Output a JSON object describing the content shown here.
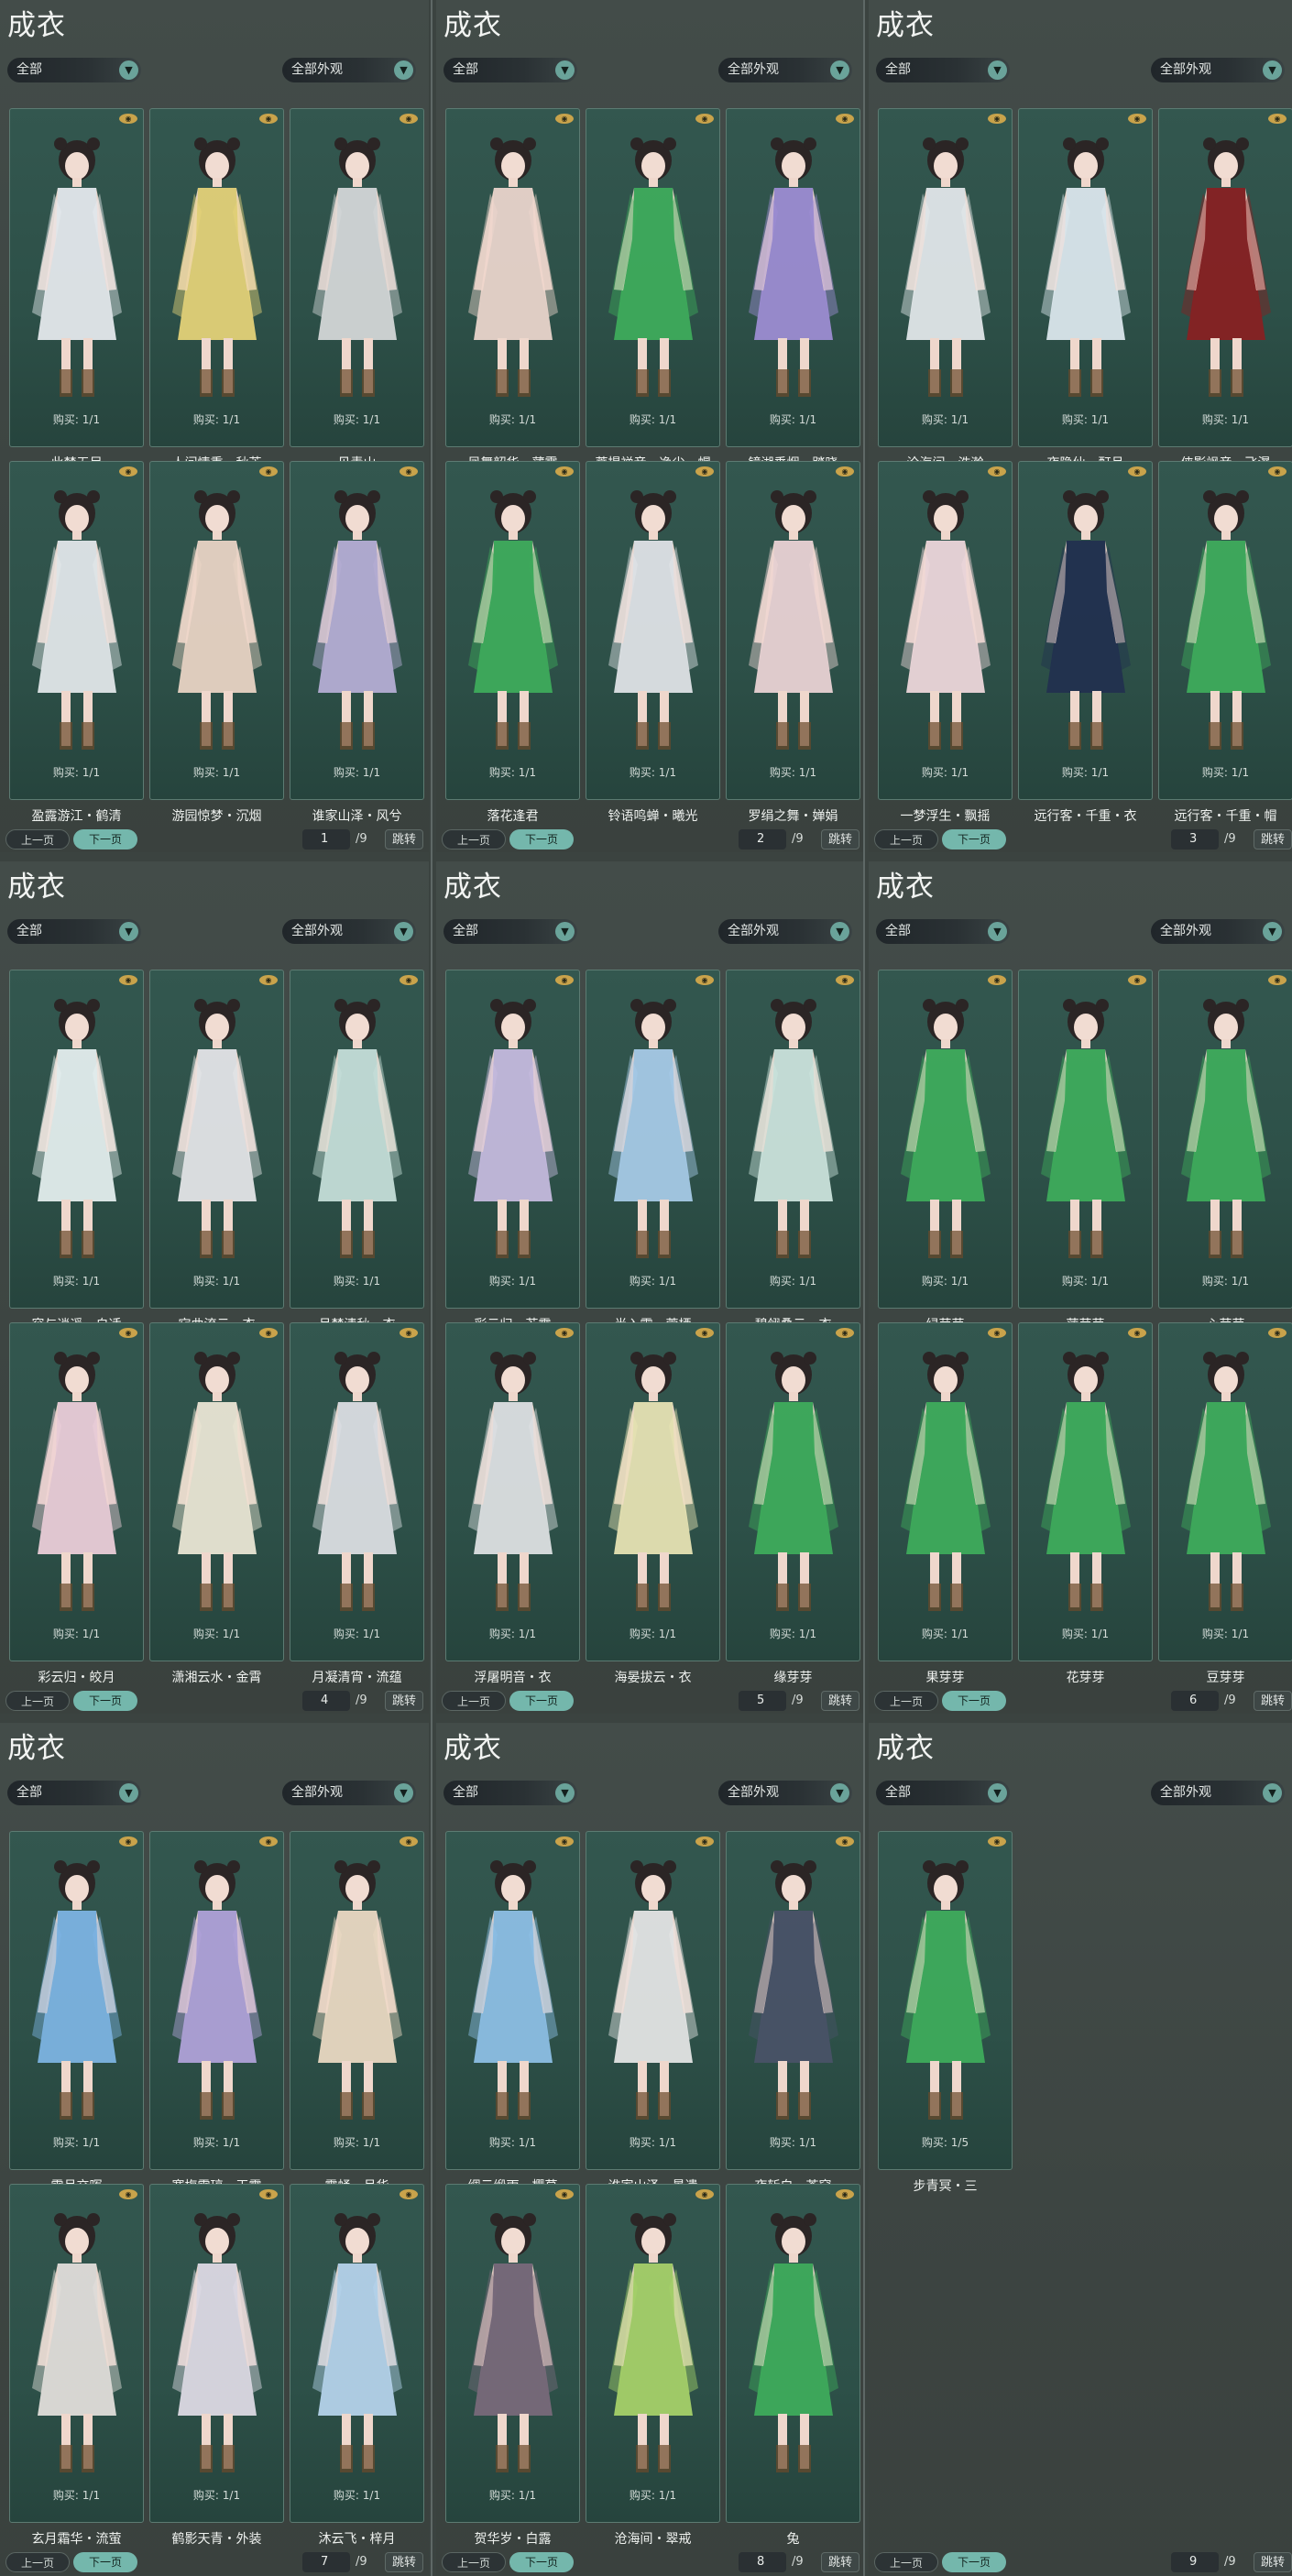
{
  "title": "成衣",
  "filter_category": "全部",
  "filter_appearance": "全部外观",
  "next_label": "下一页",
  "prev_label": "上一页",
  "jump_label": "跳转",
  "eye_icon": "eye-icon",
  "colors": {
    "background": "#3b4340",
    "card": "#2d5048",
    "accent": "#74b7ac",
    "eye": "#c9a34b"
  },
  "panels": [
    {
      "page": "1",
      "total": "/9",
      "items": [
        {
          "name": "此梦无尽",
          "buy": "购买: 1/1",
          "color": "#e9edf1"
        },
        {
          "name": "人间情重・秋芳",
          "buy": "购买: 1/1",
          "color": "#e8d57a"
        },
        {
          "name": "见青山",
          "buy": "购买: 1/1",
          "color": "#d8dadb"
        },
        {
          "name": "盈露游江・鹤清",
          "buy": "购买: 1/1",
          "color": "#e6eaee"
        },
        {
          "name": "游园惊梦・沉烟",
          "buy": "购买: 1/1",
          "color": "#eed7c8"
        },
        {
          "name": "谁家山泽・风兮",
          "buy": "购买: 1/1",
          "color": "#b8b0d8"
        }
      ]
    },
    {
      "page": "2",
      "total": "/9",
      "items": [
        {
          "name": "凤舞韶华・薄雾",
          "buy": "购买: 1/1",
          "color": "#efd8cf"
        },
        {
          "name": "菩提禅音・净尘・帽",
          "buy": "购买: 1/1",
          "color": "#3fae5c"
        },
        {
          "name": "镜湖垂烟・踏晓",
          "buy": "购买: 1/1",
          "color": "#a08ed6"
        },
        {
          "name": "落花逢君",
          "buy": "购买: 1/1",
          "color": "#3fae5c"
        },
        {
          "name": "铃语鸣蝉・曦光",
          "buy": "购买: 1/1",
          "color": "#e4e6ea"
        },
        {
          "name": "罗绢之舞・婵娟",
          "buy": "购买: 1/1",
          "color": "#efd6d8"
        }
      ]
    },
    {
      "page": "3",
      "total": "/9",
      "items": [
        {
          "name": "沧海间・浩瀚",
          "buy": "购买: 1/1",
          "color": "#e6eaee"
        },
        {
          "name": "夜隐仙・酊月",
          "buy": "购买: 1/1",
          "color": "#dfeaf1"
        },
        {
          "name": "侠影飒音・飞瀑",
          "buy": "购买: 1/1",
          "color": "#8a1f22"
        },
        {
          "name": "一梦浮生・飘摇",
          "buy": "购买: 1/1",
          "color": "#f2dade"
        },
        {
          "name": "远行客・千重・衣",
          "buy": "购买: 1/1",
          "color": "#22304f"
        },
        {
          "name": "远行客・千重・帽",
          "buy": "购买: 1/1",
          "color": "#3fae5c"
        }
      ]
    },
    {
      "page": "4",
      "total": "/9",
      "items": [
        {
          "name": "容与逍遥・自适",
          "buy": "购买: 1/1",
          "color": "#e8f2f2"
        },
        {
          "name": "宛曲流云・衣",
          "buy": "购买: 1/1",
          "color": "#e8e8ec"
        },
        {
          "name": "月梦清秋・衣",
          "buy": "购买: 1/1",
          "color": "#c9e2dc"
        },
        {
          "name": "彩云归・皎月",
          "buy": "购买: 1/1",
          "color": "#f0d0dc"
        },
        {
          "name": "潇湘云水・金霄",
          "buy": "购买: 1/1",
          "color": "#efe9d8"
        },
        {
          "name": "月凝清宵・流蕴",
          "buy": "购买: 1/1",
          "color": "#e0e2e6"
        }
      ]
    },
    {
      "page": "5",
      "total": "/9",
      "items": [
        {
          "name": "彩云归・若霞",
          "buy": "购买: 1/1",
          "color": "#c9bde2"
        },
        {
          "name": "半入霜・萱栖",
          "buy": "购买: 1/1",
          "color": "#a9cdea"
        },
        {
          "name": "碧翎叠云・衣",
          "buy": "购买: 1/1",
          "color": "#cfe6e0"
        },
        {
          "name": "浮屠明音・衣",
          "buy": "购买: 1/1",
          "color": "#e2e4e6"
        },
        {
          "name": "海晏拔云・衣",
          "buy": "购买: 1/1",
          "color": "#ece6b6"
        },
        {
          "name": "缘芽芽",
          "buy": "购买: 1/1",
          "color": "#3fae5c"
        }
      ]
    },
    {
      "page": "6",
      "total": "/9",
      "items": [
        {
          "name": "绿芽芽",
          "buy": "购买: 1/1",
          "color": "#3fae5c"
        },
        {
          "name": "萍芽芽",
          "buy": "购买: 1/1",
          "color": "#3fae5c"
        },
        {
          "name": "心芽芽",
          "buy": "购买: 1/1",
          "color": "#3fae5c"
        },
        {
          "name": "果芽芽",
          "buy": "购买: 1/1",
          "color": "#3fae5c"
        },
        {
          "name": "花芽芽",
          "buy": "购买: 1/1",
          "color": "#3fae5c"
        },
        {
          "name": "豆芽芽",
          "buy": "购买: 1/1",
          "color": "#3fae5c"
        }
      ]
    },
    {
      "page": "7",
      "total": "/9",
      "items": [
        {
          "name": "雪月交晖",
          "buy": "购买: 1/1",
          "color": "#7fb6e6"
        },
        {
          "name": "寒梅雪琼・玉露",
          "buy": "购买: 1/1",
          "color": "#b3a4dc"
        },
        {
          "name": "霞蛹・月华",
          "buy": "购买: 1/1",
          "color": "#efdcc6"
        },
        {
          "name": "玄月霜华・流萤",
          "buy": "购买: 1/1",
          "color": "#e6e2de"
        },
        {
          "name": "鹤影天青・外装",
          "buy": "购买: 1/1",
          "color": "#e2dde8"
        },
        {
          "name": "沐云飞・梓月",
          "buy": "购买: 1/1",
          "color": "#b9d6ef"
        }
      ]
    },
    {
      "page": "8",
      "total": "/9",
      "items": [
        {
          "name": "绸云缎雨・樱草",
          "buy": "购买: 1/1",
          "color": "#8fc1e8"
        },
        {
          "name": "谁家山泽・景遗",
          "buy": "购买: 1/1",
          "color": "#e8e8e8"
        },
        {
          "name": "夜斩白・苍穹",
          "buy": "购买: 1/1",
          "color": "#4a5268"
        },
        {
          "name": "贺华岁・白露",
          "buy": "购买: 1/1",
          "color": "#7b6a7c"
        },
        {
          "name": "沧海间・翠戒",
          "buy": "购买: 1/1",
          "color": "#a9d46a"
        },
        {
          "name": "兔",
          "buy": "",
          "color": "#3fae5c"
        }
      ]
    },
    {
      "page": "9",
      "total": "/9",
      "items": [
        {
          "name": "步青冥・三",
          "buy": "购买: 1/5",
          "color": "#3fae5c"
        }
      ]
    }
  ]
}
